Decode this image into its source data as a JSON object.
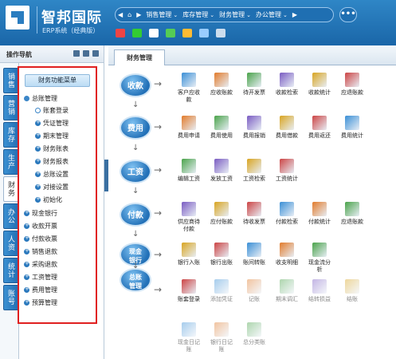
{
  "app": {
    "name": "智邦国际",
    "subtitle": "ERP系统（经典版）"
  },
  "topnav": {
    "home": "⌂",
    "items": [
      {
        "label": "销售管理"
      },
      {
        "label": "库存管理"
      },
      {
        "label": "财务管理"
      },
      {
        "label": "办公管理"
      }
    ],
    "more": "•••"
  },
  "sidebar": {
    "title": "操作导航",
    "vtabs": [
      "销售",
      "营销",
      "库存",
      "生产",
      "财务",
      "办公",
      "人资",
      "统计",
      "账号"
    ],
    "menu_header": "财务功能菜单",
    "tree": [
      {
        "label": "总账管理"
      },
      {
        "label": "账套登录"
      },
      {
        "label": "凭证管理"
      },
      {
        "label": "期末管理"
      },
      {
        "label": "财务账表"
      },
      {
        "label": "财务报表"
      },
      {
        "label": "总账设置"
      },
      {
        "label": "对接设置"
      },
      {
        "label": "初始化"
      },
      {
        "label": "现金银行"
      },
      {
        "label": "收款开票"
      },
      {
        "label": "付款收票"
      },
      {
        "label": "销售退款"
      },
      {
        "label": "采购退款"
      },
      {
        "label": "工资管理"
      },
      {
        "label": "费用管理"
      },
      {
        "label": "预算管理"
      }
    ]
  },
  "tab": {
    "label": "财务管理"
  },
  "categories": [
    "收款",
    "费用",
    "工资",
    "付款",
    "现金银行",
    "总账管理"
  ],
  "rows": [
    [
      {
        "label": "客户应收款",
        "icon": "customer-receivable-icon"
      },
      {
        "label": "应收账款",
        "icon": "receivable-icon"
      },
      {
        "label": "待开发票",
        "icon": "invoice-pending-icon"
      },
      {
        "label": "收款检索",
        "icon": "receipt-search-icon"
      },
      {
        "label": "收款统计",
        "icon": "receipt-stats-icon"
      },
      {
        "label": "应退账款",
        "icon": "refund-payable-icon"
      }
    ],
    [
      {
        "label": "费用申请",
        "icon": "expense-apply-icon"
      },
      {
        "label": "费用使用",
        "icon": "expense-use-icon"
      },
      {
        "label": "费用报销",
        "icon": "expense-reimburse-icon"
      },
      {
        "label": "费用借款",
        "icon": "expense-loan-icon"
      },
      {
        "label": "费用返还",
        "icon": "expense-return-icon"
      },
      {
        "label": "费用统计",
        "icon": "expense-stats-icon"
      }
    ],
    [
      {
        "label": "编辑工资",
        "icon": "edit-salary-icon"
      },
      {
        "label": "发放工资",
        "icon": "pay-salary-icon"
      },
      {
        "label": "工资检索",
        "icon": "salary-search-icon"
      },
      {
        "label": "工资统计",
        "icon": "salary-stats-icon"
      }
    ],
    [
      {
        "label": "供应商待付款",
        "icon": "supplier-payable-icon"
      },
      {
        "label": "应付账款",
        "icon": "payable-icon"
      },
      {
        "label": "待收发票",
        "icon": "invoice-receive-icon"
      },
      {
        "label": "付款检索",
        "icon": "payment-search-icon"
      },
      {
        "label": "付款统计",
        "icon": "payment-stats-icon"
      },
      {
        "label": "应退账款",
        "icon": "refund-receivable-icon"
      }
    ],
    [
      {
        "label": "银行入账",
        "icon": "bank-deposit-icon"
      },
      {
        "label": "银行出账",
        "icon": "bank-withdraw-icon"
      },
      {
        "label": "账间转账",
        "icon": "transfer-icon"
      },
      {
        "label": "收支明细",
        "icon": "income-expense-icon"
      },
      {
        "label": "现金流分析",
        "icon": "cashflow-icon"
      }
    ],
    [
      {
        "label": "账套登录",
        "icon": "ledger-login-icon"
      },
      {
        "label": "添加凭证",
        "icon": "add-voucher-icon"
      },
      {
        "label": "记账",
        "icon": "bookkeeping-icon"
      },
      {
        "label": "期末调汇",
        "icon": "period-exchange-icon"
      },
      {
        "label": "结转损益",
        "icon": "carry-forward-icon"
      },
      {
        "label": "结账",
        "icon": "closing-icon"
      }
    ],
    [
      {
        "label": "现金日记账",
        "icon": "cash-journal-icon"
      },
      {
        "label": "银行日记账",
        "icon": "bank-journal-icon"
      },
      {
        "label": "总分类账",
        "icon": "general-ledger-icon"
      }
    ]
  ],
  "colors": {
    "header": "#1a66a8",
    "accent": "#2371b8",
    "highlight": "#e02020"
  }
}
